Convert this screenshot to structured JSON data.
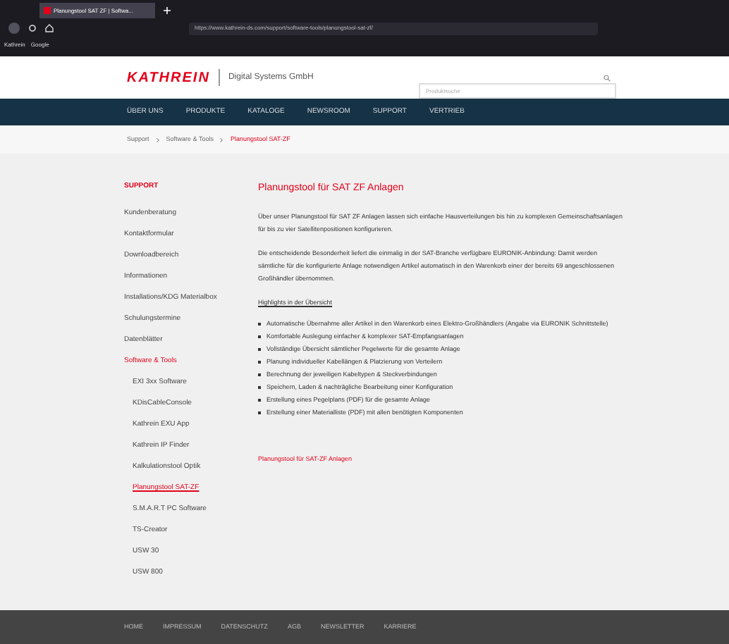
{
  "browser": {
    "tab_title": "Planungstool SAT ZF | Softwa...",
    "address": "https://www.kathrein-ds.com/support/software-tools/planungstool-sat-zf/",
    "bookmarks": [
      "Kathrein",
      "Google"
    ]
  },
  "header": {
    "logo": "KATHREIN",
    "subtitle": "Digital Systems GmbH",
    "search": {
      "placeholder": "Produktsuche"
    }
  },
  "nav": [
    "ÜBER UNS",
    "PRODUKTE",
    "KATALOGE",
    "NEWSROOM",
    "SUPPORT",
    "VERTRIEB"
  ],
  "breadcrumb": [
    {
      "label": "Support",
      "selected": false
    },
    {
      "label": "Software & Tools",
      "selected": false
    },
    {
      "label": "Planungstool SAT-ZF",
      "selected": true
    }
  ],
  "sidebar": {
    "title": "SUPPORT",
    "items": [
      {
        "label": "Kundenberatung",
        "selected": false
      },
      {
        "label": "Kontaktformular",
        "selected": false
      },
      {
        "label": "Downloadbereich",
        "selected": false
      },
      {
        "label": "Informationen",
        "selected": false
      },
      {
        "label": "Installations/KDG Materialbox",
        "selected": false
      },
      {
        "label": "Schulungstermine",
        "selected": false
      },
      {
        "label": "Datenblätter",
        "selected": false
      },
      {
        "label": "Software & Tools",
        "selected": true,
        "children": [
          {
            "label": "EXI 3xx Software",
            "selected": false
          },
          {
            "label": "KDisCableConsole",
            "selected": false
          },
          {
            "label": "Kathrein EXU App",
            "selected": false
          },
          {
            "label": "Kathrein IP Finder",
            "selected": false
          },
          {
            "label": "Kalkulationstool Optik",
            "selected": false
          },
          {
            "label": "Planungstool SAT-ZF",
            "selected": true
          },
          {
            "label": "S.M.A.R.T PC Software",
            "selected": false
          },
          {
            "label": "TS-Creator",
            "selected": false
          },
          {
            "label": "USW 30",
            "selected": false
          },
          {
            "label": "USW 800",
            "selected": false
          }
        ]
      }
    ]
  },
  "main": {
    "heading": "Planungstool für SAT ZF Anlagen",
    "paragraphs": [
      "Über unser Planungstool für SAT ZF Anlagen lassen sich einfache Hausverteilungen bis hin zu komplexen Gemeinschaftsanlagen für bis zu vier Satellitenpositionen konfigurieren.",
      "Die entscheidende Besonderheit liefert die einmalig in der SAT-Branche verfügbare EURONIK-Anbindung: Damit werden sämtliche für die konfigurierte Anlage notwendigen Artikel automatisch in den Warenkorb einer der bereits 69 angeschlossenen Großhändler übernommen."
    ],
    "highlights_title": "Highlights in der Übersicht",
    "bullets": [
      "Automatische Übernahme aller Artikel in den Warenkorb eines Elektro-Großhändlers (Angabe via EURONIK Schnittstelle)",
      "Komfortable Auslegung einfacher & komplexer SAT-Empfangsanlagen",
      "Vollständige Übersicht sämtlicher Pegelwerte für die gesamte Anlage",
      "Planung individueller Kabellängen & Platzierung von Verteilern",
      "Berechnung der jeweiligen Kabeltypen & Steckverbindungen",
      "Speichern, Laden & nachträgliche Bearbeitung einer Konfiguration",
      "Erstellung eines Pegelplans (PDF) für die gesamte Anlage",
      "Erstellung einer Materialliste (PDF) mit allen benötigten Komponenten"
    ],
    "link": "Planungstool für SAT-ZF Anlagen"
  },
  "footer": [
    "HOME",
    "IMPRESSUM",
    "DATENSCHUTZ",
    "AGB",
    "NEWSLETTER",
    "KARRIERE"
  ]
}
